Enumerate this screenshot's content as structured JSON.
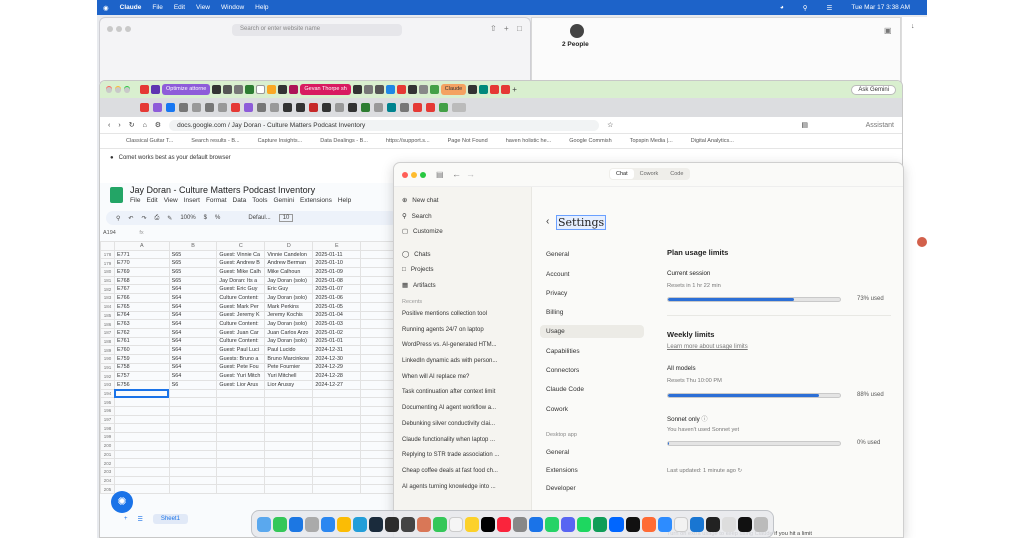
{
  "menubar": {
    "app": "Claude",
    "items": [
      "File",
      "Edit",
      "View",
      "Window",
      "Help"
    ],
    "datetime": "Tue Mar 17  3:38 AM"
  },
  "safari": {
    "url_placeholder": "Search or enter website name"
  },
  "facetime": {
    "people": "2 People"
  },
  "chrome": {
    "tab_labels": [
      "Optimize attorne",
      "Gevan Thorpe sh",
      "Claude"
    ],
    "ask_gemini": "Ask Gemini",
    "address": "docs.google.com / Jay Doran - Culture Matters Podcast Inventory",
    "assistant": "Assistant",
    "bookmarks": [
      "Classical Guitar T...",
      "Search results - B...",
      "Capture Insights...",
      "Data Dealings - B...",
      "https://support.s...",
      "Page Not Found",
      "haven holistic he...",
      "Google Commish",
      "Topspin Media |...",
      "Digital Analytics..."
    ],
    "infobar": "Comet works best as your default browser"
  },
  "sheet": {
    "title": "Jay Doran - Culture Matters Podcast Inventory",
    "menu": [
      "File",
      "Edit",
      "View",
      "Insert",
      "Format",
      "Data",
      "Tools",
      "Gemini",
      "Extensions",
      "Help"
    ],
    "zoom": "100%",
    "font": "Defaul...",
    "font_size": "10",
    "namebox": "A194",
    "fx": "fx",
    "columns": [
      "A",
      "B",
      "C",
      "D",
      "E"
    ],
    "rows": [
      {
        "n": "178",
        "a": "E771",
        "b": "S65",
        "c": "Guest: Vinnie Ca",
        "d": "Vinnie Candelon",
        "e": "2025-01-11"
      },
      {
        "n": "179",
        "a": "E770",
        "b": "S65",
        "c": "Guest: Andrew B",
        "d": "Andrew Berman",
        "e": "2025-01-10"
      },
      {
        "n": "180",
        "a": "E769",
        "b": "S65",
        "c": "Guest: Mike Calh",
        "d": "Mike Calhoun",
        "e": "2025-01-09"
      },
      {
        "n": "181",
        "a": "E768",
        "b": "S65",
        "c": "Jay Doran: Its a",
        "d": "Jay Doran (solo)",
        "e": "2025-01-08"
      },
      {
        "n": "182",
        "a": "E767",
        "b": "S64",
        "c": "Guest: Eric Guy",
        "d": "Eric Guy",
        "e": "2025-01-07"
      },
      {
        "n": "183",
        "a": "E766",
        "b": "S64",
        "c": "Culture Content:",
        "d": "Jay Doran (solo)",
        "e": "2025-01-06"
      },
      {
        "n": "184",
        "a": "E765",
        "b": "S64",
        "c": "Guest: Mark Per",
        "d": "Mark Perkins",
        "e": "2025-01-05"
      },
      {
        "n": "185",
        "a": "E764",
        "b": "S64",
        "c": "Guest: Jeremy K",
        "d": "Jeremy Kochis",
        "e": "2025-01-04"
      },
      {
        "n": "186",
        "a": "E763",
        "b": "S64",
        "c": "Culture Content:",
        "d": "Jay Doran (solo)",
        "e": "2025-01-03"
      },
      {
        "n": "187",
        "a": "E762",
        "b": "S64",
        "c": "Guest: Juan Car",
        "d": "Juan Carlos Arzo",
        "e": "2025-01-02"
      },
      {
        "n": "188",
        "a": "E761",
        "b": "S64",
        "c": "Culture Content:",
        "d": "Jay Doran (solo)",
        "e": "2025-01-01"
      },
      {
        "n": "189",
        "a": "E760",
        "b": "S64",
        "c": "Guest: Paul Luci",
        "d": "Paul Lucido",
        "e": "2024-12-31"
      },
      {
        "n": "190",
        "a": "E759",
        "b": "S64",
        "c": "Guests: Bruno a",
        "d": "Bruno Marcinkow",
        "e": "2024-12-30"
      },
      {
        "n": "191",
        "a": "E758",
        "b": "S64",
        "c": "Guest: Pete Fou",
        "d": "Pete Fournier",
        "e": "2024-12-29"
      },
      {
        "n": "192",
        "a": "E757",
        "b": "S64",
        "c": "Guest: Yuri Mitch",
        "d": "Yuri Mitchell",
        "e": "2024-12-28"
      },
      {
        "n": "193",
        "a": "E756",
        "b": "S6",
        "c": "Guest: Lior Arus",
        "d": "Lior Arussy",
        "e": "2024-12-27"
      },
      {
        "n": "194",
        "a": "",
        "b": "",
        "c": "",
        "d": "",
        "e": ""
      },
      {
        "n": "195",
        "a": "",
        "b": "",
        "c": "",
        "d": "",
        "e": ""
      },
      {
        "n": "196",
        "a": "",
        "b": "",
        "c": "",
        "d": "",
        "e": ""
      },
      {
        "n": "197",
        "a": "",
        "b": "",
        "c": "",
        "d": "",
        "e": ""
      },
      {
        "n": "198",
        "a": "",
        "b": "",
        "c": "",
        "d": "",
        "e": ""
      },
      {
        "n": "199",
        "a": "",
        "b": "",
        "c": "",
        "d": "",
        "e": ""
      },
      {
        "n": "200",
        "a": "",
        "b": "",
        "c": "",
        "d": "",
        "e": ""
      },
      {
        "n": "201",
        "a": "",
        "b": "",
        "c": "",
        "d": "",
        "e": ""
      },
      {
        "n": "202",
        "a": "",
        "b": "",
        "c": "",
        "d": "",
        "e": ""
      },
      {
        "n": "203",
        "a": "",
        "b": "",
        "c": "",
        "d": "",
        "e": ""
      },
      {
        "n": "204",
        "a": "",
        "b": "",
        "c": "",
        "d": "",
        "e": ""
      },
      {
        "n": "205",
        "a": "",
        "b": "",
        "c": "",
        "d": "",
        "e": ""
      }
    ],
    "sheet_tab": "Sheet1"
  },
  "claude": {
    "mode_tabs": [
      "Chat",
      "Cowork",
      "Code"
    ],
    "active_mode": "Chat",
    "sidebar": {
      "top": [
        "New chat",
        "Search",
        "Customize"
      ],
      "sections": [
        "Chats",
        "Projects",
        "Artifacts"
      ],
      "recents_label": "Recents",
      "recents": [
        "Positive mentions collection tool",
        "Running agents 24/7 on laptop",
        "WordPress vs. AI-generated HTM...",
        "LinkedIn dynamic ads with person...",
        "When will AI replace me?",
        "Task continuation after context limit",
        "Documenting AI agent workflow a...",
        "Debunking silver conductivity clai...",
        "Claude functionality when laptop ...",
        "Replying to STR trade association ...",
        "Cheap coffee deals at fast food ch...",
        "AI agents turning knowledge into ..."
      ]
    },
    "settings": {
      "title": "Settings",
      "nav": [
        "General",
        "Account",
        "Privacy",
        "Billing",
        "Usage",
        "Capabilities",
        "Connectors",
        "Claude Code",
        "Cowork"
      ],
      "selected": "Usage",
      "desktop_label": "Desktop app",
      "desktop_nav": [
        "General",
        "Extensions",
        "Developer"
      ]
    },
    "usage": {
      "plan_title": "Plan usage limits",
      "current_session": "Current session",
      "session_reset": "Resets in 1 hr 22 min",
      "session_pct": 0.73,
      "session_label": "73% used",
      "weekly_title": "Weekly limits",
      "learn_more": "Learn more about usage limits",
      "all_models": "All models",
      "all_reset": "Resets Thu 10:00 PM",
      "all_pct": 0.88,
      "all_label": "88% used",
      "sonnet_only": "Sonnet only",
      "sonnet_sub": "You haven't used Sonnet yet",
      "sonnet_pct": 0.0,
      "sonnet_label": "0% used",
      "last_updated": "Last updated: 1 minute ago",
      "extra_usage": "Turn on extra usage to keep using Claude if you hit a limit"
    }
  }
}
